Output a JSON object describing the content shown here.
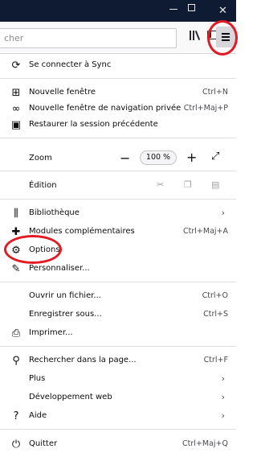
{
  "window": {
    "close_glyph": "✕"
  },
  "toolbar": {
    "search_text": "cher"
  },
  "menu": {
    "sync": "Se connecter à Sync",
    "new_window": {
      "label": "Nouvelle fenêtre",
      "shortcut": "Ctrl+N"
    },
    "private_window": {
      "label": "Nouvelle fenêtre de navigation privée",
      "shortcut": "Ctrl+Maj+P"
    },
    "restore_session": "Restaurer la session précédente",
    "zoom": {
      "label": "Zoom",
      "value": "100 %"
    },
    "edit": "Édition",
    "library": "Bibliothèque",
    "addons": {
      "label": "Modules complémentaires",
      "shortcut": "Ctrl+Maj+A"
    },
    "options": "Options",
    "customize": "Personnaliser...",
    "open_file": {
      "label": "Ouvrir un fichier...",
      "shortcut": "Ctrl+O"
    },
    "save_as": {
      "label": "Enregistrer sous...",
      "shortcut": "Ctrl+S"
    },
    "print": "Imprimer...",
    "find": {
      "label": "Rechercher dans la page...",
      "shortcut": "Ctrl+F"
    },
    "more": "Plus",
    "web_dev": "Développement web",
    "help": "Aide",
    "quit": {
      "label": "Quitter",
      "shortcut": "Ctrl+Maj+Q"
    }
  },
  "colors": {
    "titlebar": "#0f1a33",
    "annotation": "#e01b24"
  }
}
